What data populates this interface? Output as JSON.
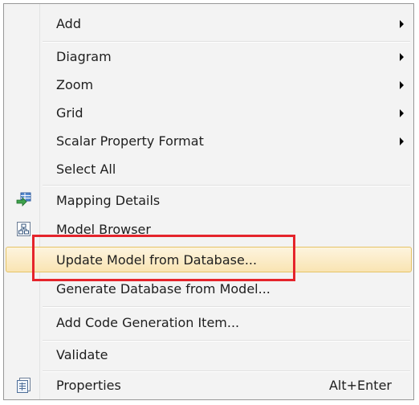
{
  "menu": {
    "items": [
      {
        "label": "Add",
        "submenu": true
      },
      {
        "label": "Diagram",
        "submenu": true
      },
      {
        "label": "Zoom",
        "submenu": true
      },
      {
        "label": "Grid",
        "submenu": true
      },
      {
        "label": "Scalar Property Format",
        "submenu": true
      },
      {
        "label": "Select All"
      },
      {
        "label": "Mapping Details",
        "icon": "mapping-details-icon"
      },
      {
        "label": "Model Browser",
        "icon": "model-browser-icon"
      },
      {
        "label": "Update Model from Database...",
        "highlighted": true
      },
      {
        "label": "Generate Database from Model..."
      },
      {
        "label": "Add Code Generation Item..."
      },
      {
        "label": "Validate"
      },
      {
        "label": "Properties",
        "icon": "properties-icon",
        "shortcut": "Alt+Enter"
      }
    ]
  },
  "colors": {
    "highlight_border": "#e5c365",
    "highlight_fill": "#fbecc6",
    "annotation_box": "#e5242b"
  }
}
